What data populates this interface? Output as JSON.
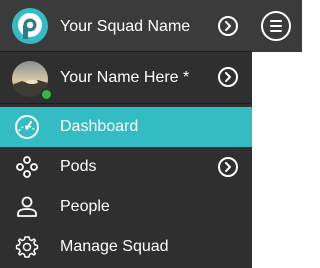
{
  "header": {
    "squad_name": "Your Squad Name",
    "logo_icon": "squad-logo-icon"
  },
  "user": {
    "name": "Your Name Here *",
    "status": "online",
    "status_color": "#2fb84c"
  },
  "nav": {
    "items": [
      {
        "label": "Dashboard",
        "icon": "dashboard-gauge-icon",
        "active": true
      },
      {
        "label": "Pods",
        "icon": "pods-icon",
        "has_submenu": true
      },
      {
        "label": "People",
        "icon": "person-icon"
      },
      {
        "label": "Manage Squad",
        "icon": "gear-icon"
      }
    ]
  },
  "colors": {
    "sidebar_bg": "#2f2f2f",
    "header_bg": "#3b3b3b",
    "accent": "#33bcc4",
    "text": "#ffffff"
  }
}
